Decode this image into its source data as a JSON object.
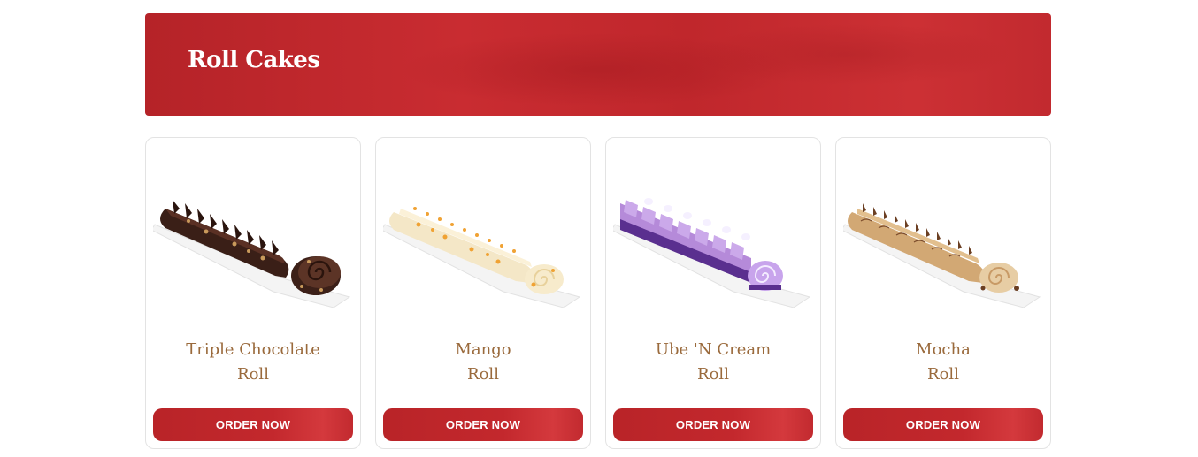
{
  "section": {
    "title": "Roll Cakes"
  },
  "products": [
    {
      "name_line1": "Triple Chocolate",
      "name_line2": "Roll",
      "button_label": "ORDER NOW",
      "image_icon": "triple-chocolate-roll-image"
    },
    {
      "name_line1": "Mango",
      "name_line2": "Roll",
      "button_label": "ORDER NOW",
      "image_icon": "mango-roll-image"
    },
    {
      "name_line1": "Ube 'N Cream",
      "name_line2": "Roll",
      "button_label": "ORDER NOW",
      "image_icon": "ube-n-cream-roll-image"
    },
    {
      "name_line1": "Mocha",
      "name_line2": "Roll",
      "button_label": "ORDER NOW",
      "image_icon": "mocha-roll-image"
    }
  ],
  "colors": {
    "brand_red": "#c0272c",
    "title_brown": "#9a6a3c",
    "card_border": "#e3e3e3"
  }
}
